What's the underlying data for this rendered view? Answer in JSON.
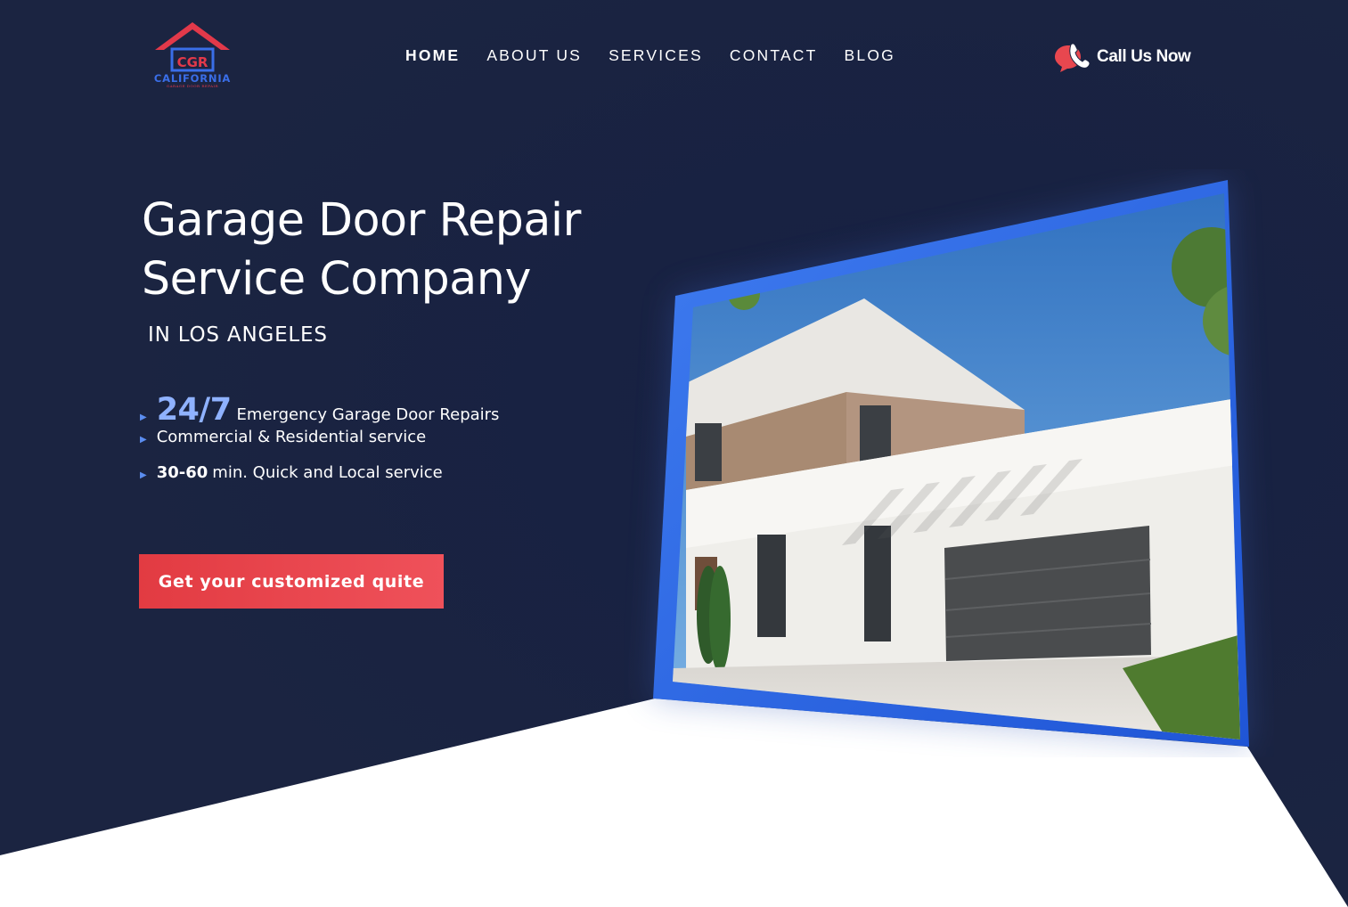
{
  "brand": {
    "logo_monogram": "CGR",
    "logo_name": "CALIFORNIA",
    "logo_tagline": "GARAGE DOOR REPAIR"
  },
  "nav": {
    "items": [
      {
        "label": "HOME",
        "active": true
      },
      {
        "label": "ABOUT US",
        "active": false
      },
      {
        "label": "SERVICES",
        "active": false
      },
      {
        "label": "CONTACT",
        "active": false
      },
      {
        "label": "BLOG",
        "active": false
      }
    ]
  },
  "call": {
    "label": "Call Us Now",
    "icon": "phone-chat-icon"
  },
  "hero": {
    "title_line1": "Garage Door Repair",
    "title_line2": "Service Company",
    "subtitle": "IN LOS ANGELES",
    "features": [
      {
        "highlight": "24/7",
        "text": "Emergency Garage Door Repairs"
      },
      {
        "text": "Commercial & Residential service"
      },
      {
        "strong": "30-60",
        "text": "min. Quick and Local service"
      }
    ],
    "cta_label": "Get your customized quite"
  },
  "colors": {
    "navy_background": "#1b2441",
    "accent_red": "#e23b42",
    "accent_blue": "#3a6ee8",
    "highlight_blue": "#8fb2ff",
    "text_white": "#ffffff"
  }
}
